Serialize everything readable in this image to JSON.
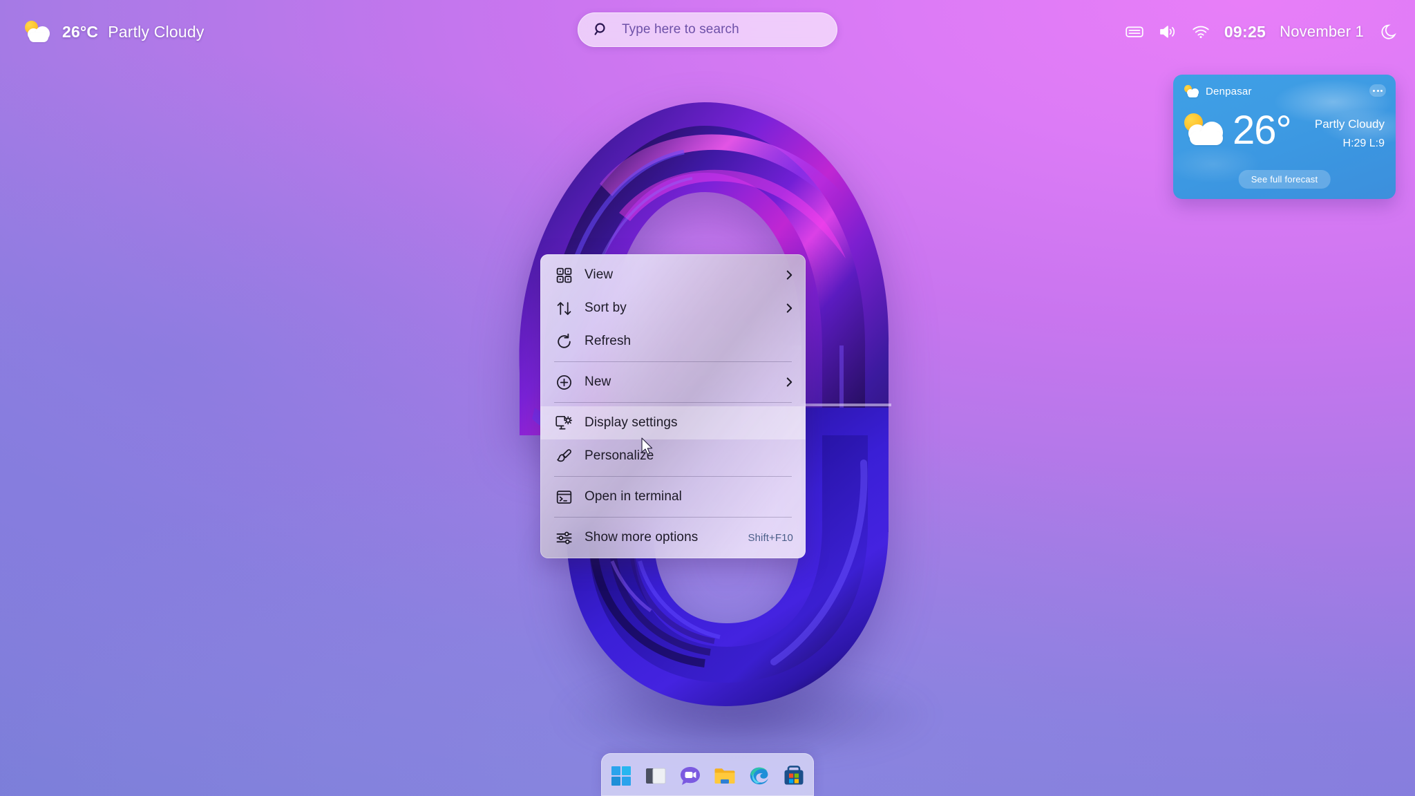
{
  "topbar": {
    "weather": {
      "icon": "partly-cloudy-icon",
      "temperature": "26°C",
      "condition": "Partly Cloudy"
    },
    "search": {
      "icon": "search-icon",
      "placeholder": "Type here to search",
      "value": ""
    },
    "tray": {
      "icons": [
        "keyboard-language-icon",
        "speaker-volume-icon",
        "wifi-icon"
      ],
      "time": "09:25",
      "date": "November 1",
      "night_mode_icon": "moon-icon"
    }
  },
  "weather_widget": {
    "city_icon": "partly-cloudy-icon",
    "city": "Denpasar",
    "more_button": "more-options-icon",
    "big_icon": "partly-cloudy-icon",
    "temperature": "26°",
    "condition": "Partly Cloudy",
    "high_low": "H:29 L:9",
    "forecast_button": "See full forecast"
  },
  "context_menu": {
    "items": [
      {
        "label": "View",
        "icon": "grid-view-icon",
        "submenu": true,
        "accel": "",
        "hovered": false,
        "separator_after": false
      },
      {
        "label": "Sort by",
        "icon": "sort-arrows-icon",
        "submenu": true,
        "accel": "",
        "hovered": false,
        "separator_after": false
      },
      {
        "label": "Refresh",
        "icon": "refresh-icon",
        "submenu": false,
        "accel": "",
        "hovered": false,
        "separator_after": true
      },
      {
        "label": "New",
        "icon": "plus-circle-icon",
        "submenu": true,
        "accel": "",
        "hovered": false,
        "separator_after": true
      },
      {
        "label": "Display settings",
        "icon": "monitor-gear-icon",
        "submenu": false,
        "accel": "",
        "hovered": true,
        "separator_after": false
      },
      {
        "label": "Personalize",
        "icon": "paintbrush-icon",
        "submenu": false,
        "accel": "",
        "hovered": false,
        "separator_after": true
      },
      {
        "label": "Open in terminal",
        "icon": "terminal-icon",
        "submenu": false,
        "accel": "",
        "hovered": false,
        "separator_after": true
      },
      {
        "label": "Show more options",
        "icon": "sliders-icon",
        "submenu": false,
        "accel": "Shift+F10",
        "hovered": false,
        "separator_after": false
      }
    ]
  },
  "taskbar": {
    "apps": [
      {
        "name": "start-button",
        "icon": "windows-logo-icon"
      },
      {
        "name": "task-view-button",
        "icon": "task-view-icon"
      },
      {
        "name": "chat-button",
        "icon": "chat-video-icon"
      },
      {
        "name": "file-explorer-button",
        "icon": "folder-icon"
      },
      {
        "name": "edge-button",
        "icon": "edge-icon"
      },
      {
        "name": "microsoft-store-button",
        "icon": "store-icon"
      }
    ]
  },
  "colors": {
    "wallpaper_pink": "#dc7bf6",
    "wallpaper_purple": "#8b7ddf",
    "wallpaper_blue": "#7c7ed9",
    "widget_blue": "#3e9ce4",
    "accel_text": "#4a5e88",
    "menu_text": "#1d1a27"
  }
}
